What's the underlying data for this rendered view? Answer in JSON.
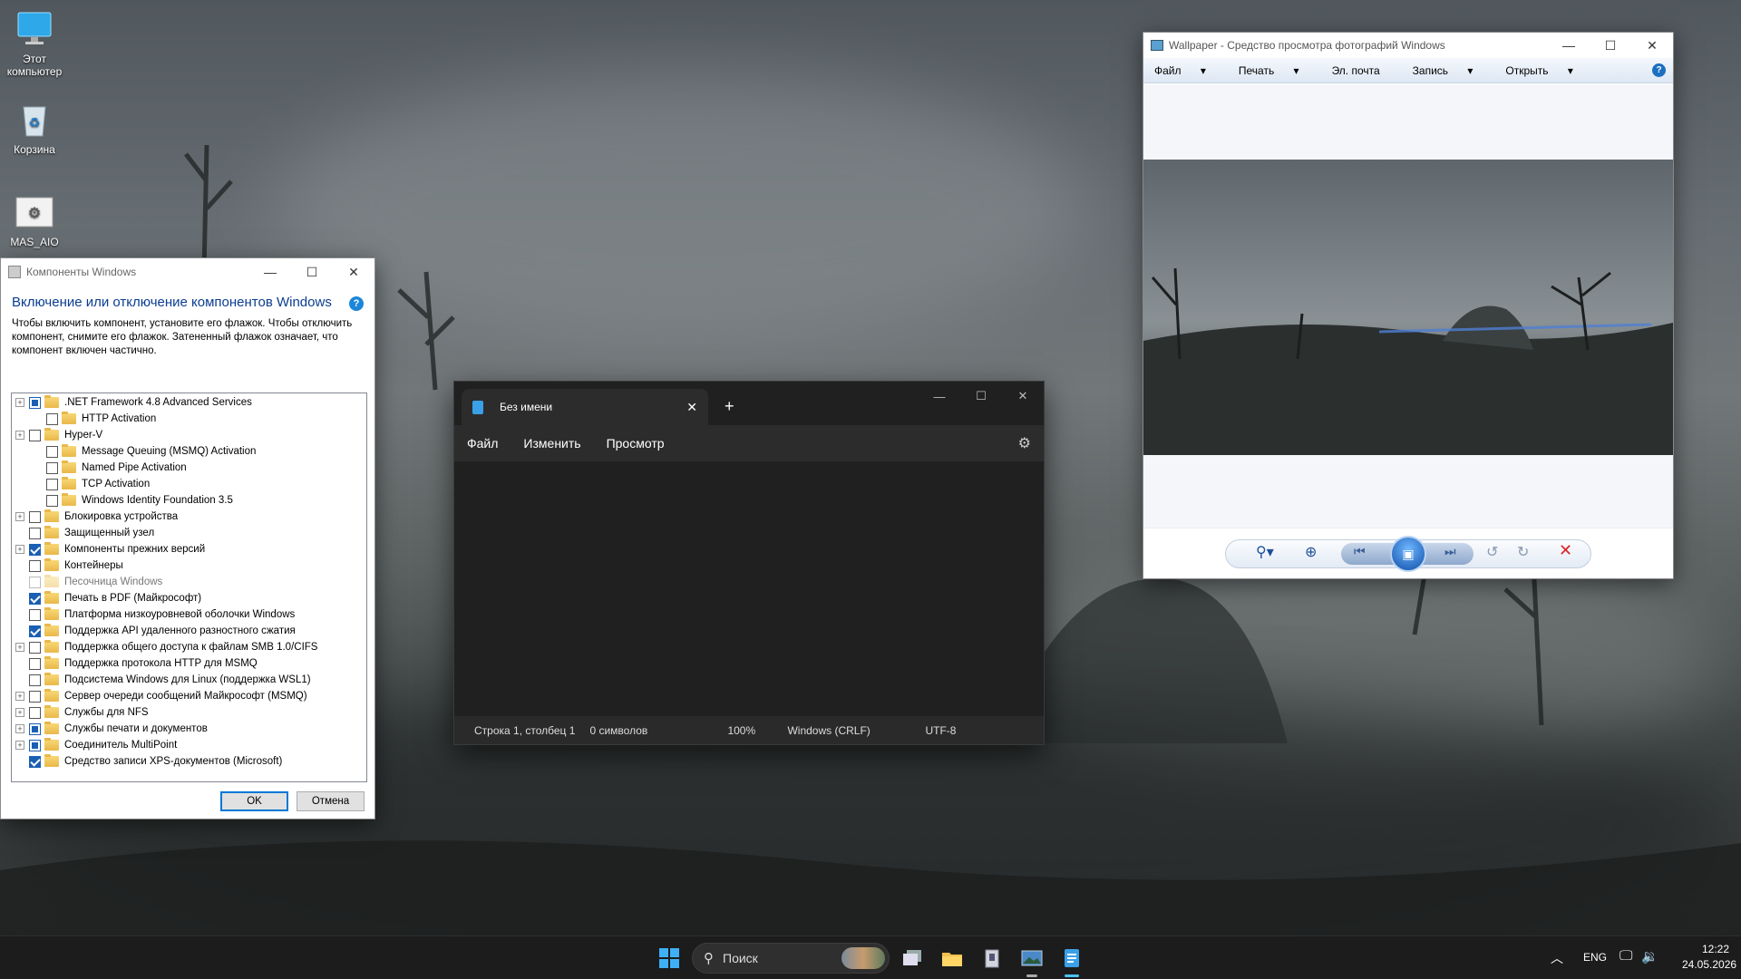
{
  "desktop": {
    "icons": [
      {
        "label": "Этот компьютер",
        "icon": "computer-icon"
      },
      {
        "label": "Корзина",
        "icon": "recycle-bin-icon"
      },
      {
        "label": "MAS_AIO",
        "icon": "script-icon"
      }
    ]
  },
  "components_window": {
    "title": "Компоненты Windows",
    "heading": "Включение или отключение компонентов Windows",
    "description": "Чтобы включить компонент, установите его флажок. Чтобы отключить компонент, снимите его флажок. Затененный флажок означает, что компонент включен частично.",
    "items": [
      {
        "label": ".NET Framework 4.8 Advanced Services",
        "state": "partial",
        "expandable": true,
        "indent": 0
      },
      {
        "label": "HTTP Activation",
        "state": "off",
        "expandable": false,
        "indent": 1
      },
      {
        "label": "Hyper-V",
        "state": "off",
        "expandable": true,
        "indent": 0
      },
      {
        "label": "Message Queuing (MSMQ) Activation",
        "state": "off",
        "expandable": false,
        "indent": 1
      },
      {
        "label": "Named Pipe Activation",
        "state": "off",
        "expandable": false,
        "indent": 1
      },
      {
        "label": "TCP Activation",
        "state": "off",
        "expandable": false,
        "indent": 1
      },
      {
        "label": "Windows Identity Foundation 3.5",
        "state": "off",
        "expandable": false,
        "indent": 1
      },
      {
        "label": "Блокировка устройства",
        "state": "off",
        "expandable": true,
        "indent": 0
      },
      {
        "label": "Защищенный узел",
        "state": "off",
        "expandable": false,
        "indent": 0
      },
      {
        "label": "Компоненты прежних версий",
        "state": "on",
        "expandable": true,
        "indent": 0
      },
      {
        "label": "Контейнеры",
        "state": "off",
        "expandable": false,
        "indent": 0
      },
      {
        "label": "Песочница Windows",
        "state": "disabled",
        "expandable": false,
        "indent": 0
      },
      {
        "label": "Печать в PDF (Майкрософт)",
        "state": "on",
        "expandable": false,
        "indent": 0
      },
      {
        "label": "Платформа низкоуровневой оболочки Windows",
        "state": "off",
        "expandable": false,
        "indent": 0
      },
      {
        "label": "Поддержка API удаленного разностного сжатия",
        "state": "on",
        "expandable": false,
        "indent": 0
      },
      {
        "label": "Поддержка общего доступа к файлам SMB 1.0/CIFS",
        "state": "off",
        "expandable": true,
        "indent": 0
      },
      {
        "label": "Поддержка протокола HTTP для MSMQ",
        "state": "off",
        "expandable": false,
        "indent": 0
      },
      {
        "label": "Подсистема Windows для Linux (поддержка WSL1)",
        "state": "off",
        "expandable": false,
        "indent": 0
      },
      {
        "label": "Сервер очереди сообщений Майкрософт (MSMQ)",
        "state": "off",
        "expandable": true,
        "indent": 0
      },
      {
        "label": "Службы для NFS",
        "state": "off",
        "expandable": true,
        "indent": 0
      },
      {
        "label": "Службы печати и документов",
        "state": "partial",
        "expandable": true,
        "indent": 0
      },
      {
        "label": "Соединитель MultiPoint",
        "state": "partial",
        "expandable": true,
        "indent": 0
      },
      {
        "label": "Средство записи XPS-документов (Microsoft)",
        "state": "on",
        "expandable": false,
        "indent": 0
      }
    ],
    "ok_label": "OK",
    "cancel_label": "Отмена"
  },
  "notepad": {
    "tab_title": "Без имени",
    "menu": [
      "Файл",
      "Изменить",
      "Просмотр"
    ],
    "status": {
      "position": "Строка 1, столбец 1",
      "chars": "0 символов",
      "zoom": "100%",
      "line_endings": "Windows (CRLF)",
      "encoding": "UTF-8"
    }
  },
  "photo_viewer": {
    "title": "Wallpaper - Средство просмотра фотографий Windows",
    "menu": [
      "Файл",
      "Печать",
      "Эл. почта",
      "Запись",
      "Открыть"
    ],
    "menu_dropdowns": [
      true,
      true,
      false,
      true,
      true
    ]
  },
  "taskbar": {
    "search_placeholder": "Поиск",
    "language": "ENG",
    "time": "12:22",
    "date": "24.05.2026"
  },
  "colors": {
    "accent": "#0078d4",
    "checkbox": "#1a5fb4",
    "heading": "#0b3d91"
  }
}
